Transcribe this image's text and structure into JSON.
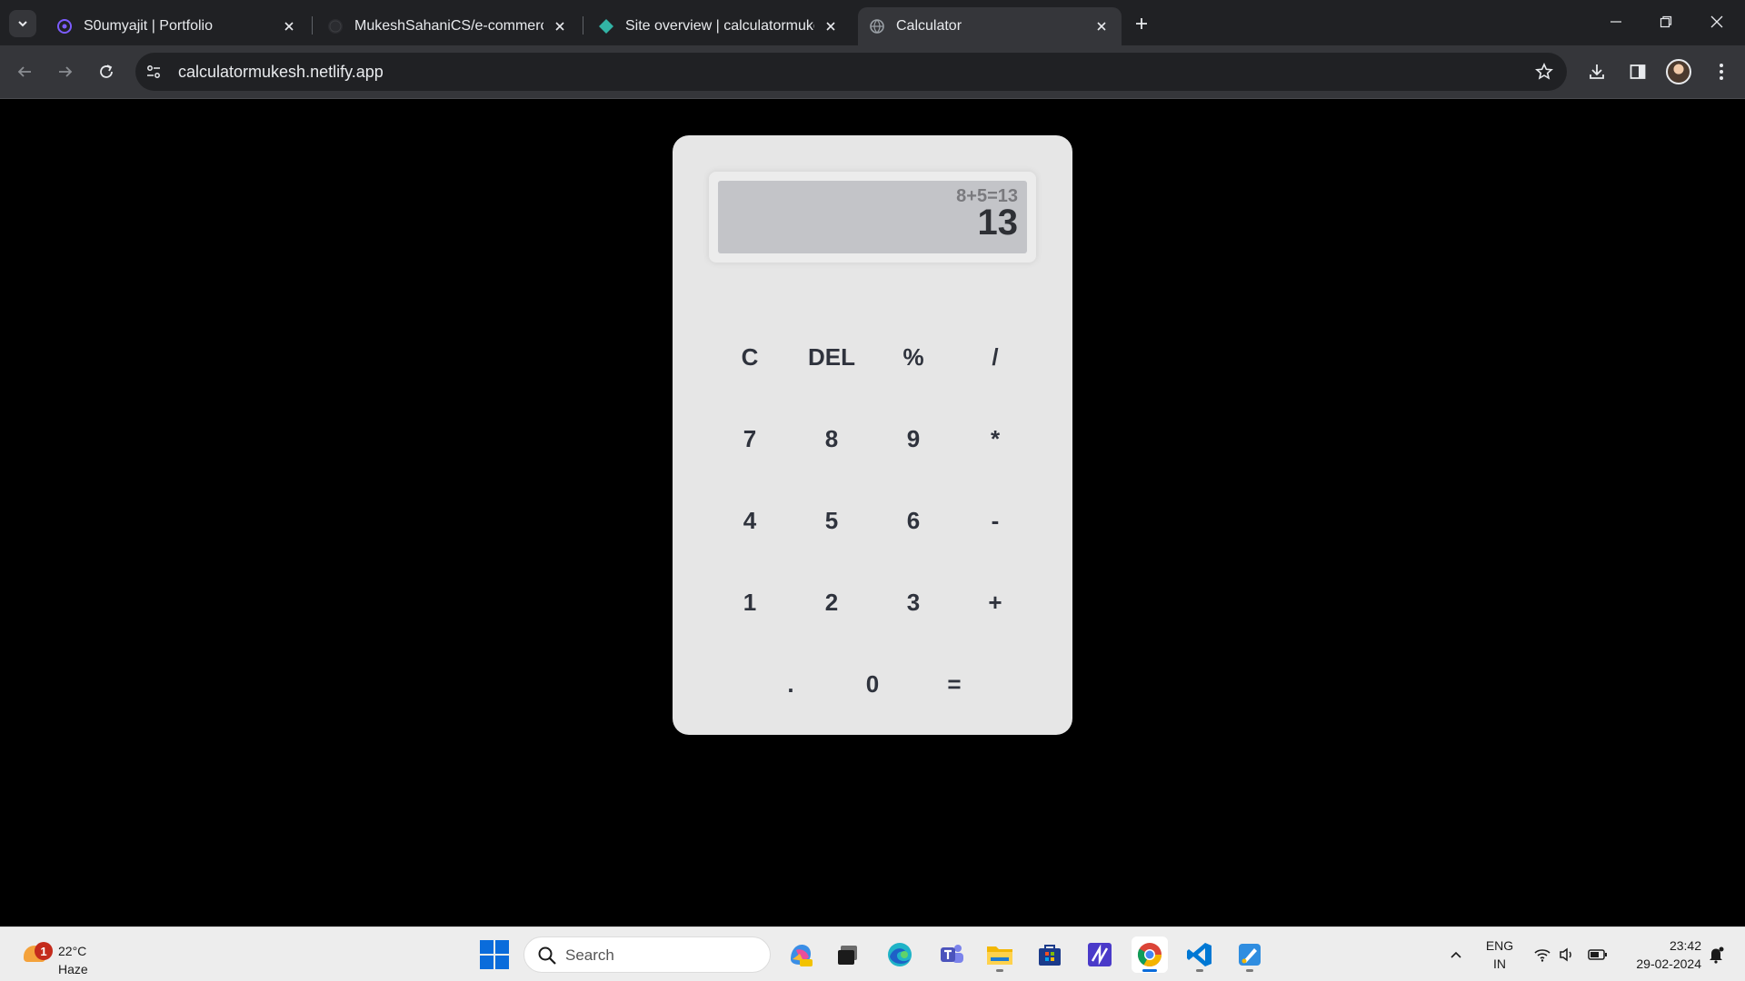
{
  "browser": {
    "tabs": [
      {
        "title": "S0umyajit | Portfolio"
      },
      {
        "title": "MukeshSahaniCS/e-commerce"
      },
      {
        "title": "Site overview | calculatormukesh"
      },
      {
        "title": "Calculator",
        "active": true
      }
    ],
    "url": "calculatormukesh.netlify.app"
  },
  "calculator": {
    "history": "8+5=13",
    "result": "13",
    "keys": {
      "clear": "C",
      "delete": "DEL",
      "percent": "%",
      "divide": "/",
      "seven": "7",
      "eight": "8",
      "nine": "9",
      "multiply": "*",
      "four": "4",
      "five": "5",
      "six": "6",
      "subtract": "-",
      "one": "1",
      "two": "2",
      "three": "3",
      "add": "+",
      "decimal": ".",
      "zero": "0",
      "equals": "="
    }
  },
  "taskbar": {
    "weather": {
      "temp": "22°C",
      "condition": "Haze",
      "badge": "1"
    },
    "search_placeholder": "Search",
    "language": {
      "line1": "ENG",
      "line2": "IN"
    },
    "time": "23:42",
    "date": "29-02-2024"
  },
  "colors": {
    "page_background": "#000000",
    "calculator_body": "#e6e6e6",
    "display": "#c3c4c8",
    "key_text": "#2f333d"
  }
}
